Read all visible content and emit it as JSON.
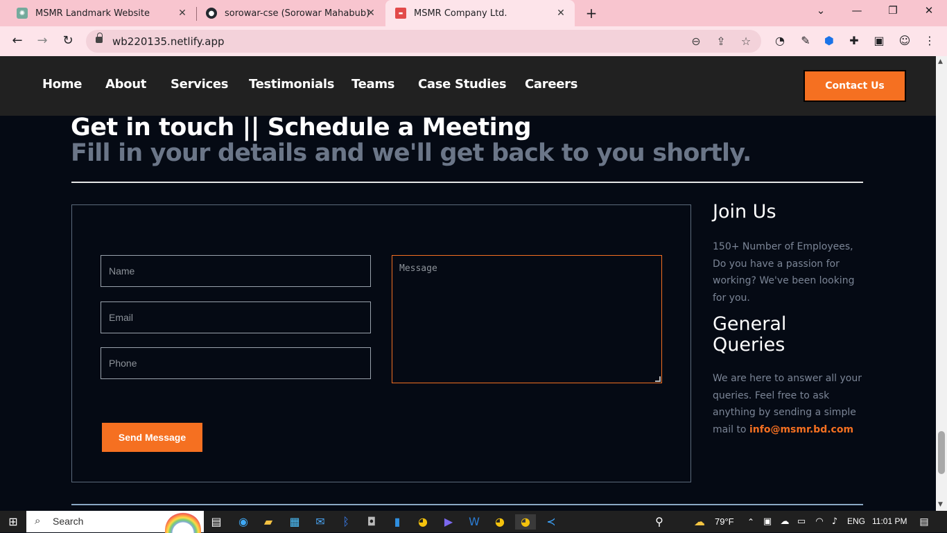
{
  "browser": {
    "tabs": [
      {
        "title": "MSMR Landmark Website",
        "icon": "chatgpt-icon",
        "active": false
      },
      {
        "title": "sorowar-cse (Sorowar Mahabub)",
        "icon": "github-icon",
        "active": false
      },
      {
        "title": "MSMR Company Ltd.",
        "icon": "site-favicon",
        "active": true
      }
    ],
    "url": "wb220135.netlify.app"
  },
  "site": {
    "nav": [
      "Home",
      "About",
      "Services",
      "Testimonials",
      "Teams",
      "Case Studies",
      "Careers"
    ],
    "contact_label": "Contact Us",
    "heading": "Get in touch || Schedule a Meeting",
    "subheading": "Fill in your details and we'll get back to you shortly.",
    "form": {
      "name_placeholder": "Name",
      "email_placeholder": "Email",
      "phone_placeholder": "Phone",
      "message_placeholder": "Message",
      "submit_label": "Send Message"
    },
    "join": {
      "title": "Join Us",
      "text": "150+ Number of Employees, Do you have a passion for working? We've been looking for you."
    },
    "queries": {
      "title_line1": "General",
      "title_line2": "Queries",
      "text": "We are here to answer all your queries. Feel free to ask anything by sending a simple mail to",
      "email": "info@msmr.bd.com"
    },
    "accent_color": "#f57021"
  },
  "taskbar": {
    "search_label": "Search",
    "weather": "79°F",
    "language": "ENG",
    "time": "11:01 PM"
  }
}
